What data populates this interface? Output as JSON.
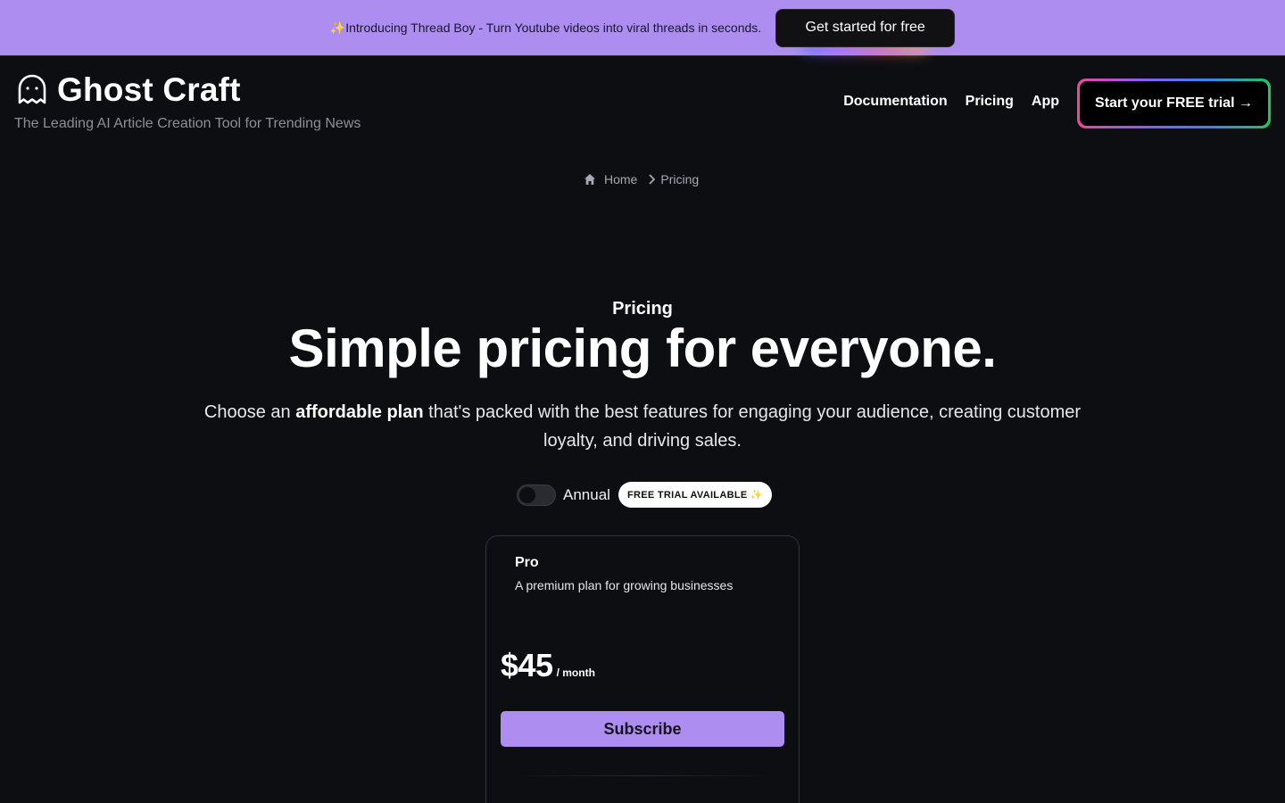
{
  "banner": {
    "text": "✨Introducing Thread Boy - Turn Youtube videos into viral threads in seconds.",
    "cta_label": "Get started for free"
  },
  "brand": {
    "name": "Ghost Craft",
    "tagline": "The Leading AI Article Creation Tool for Trending News",
    "icon": "ghost-icon"
  },
  "nav": {
    "items": [
      "Documentation",
      "Pricing",
      "App"
    ],
    "trial_label": "Start your FREE trial →"
  },
  "breadcrumb": {
    "home": "Home",
    "current": "Pricing"
  },
  "hero": {
    "eyebrow": "Pricing",
    "headline": "Simple pricing for everyone.",
    "sub_pre": "Choose an ",
    "sub_bold": "affordable plan",
    "sub_post": " that's packed with the best features for engaging your audience, creating customer loyalty, and driving sales."
  },
  "billing": {
    "toggle_label": "Annual",
    "annual_enabled": false,
    "badge": "FREE TRIAL AVAILABLE ✨"
  },
  "plan": {
    "name": "Pro",
    "description": "A premium plan for growing businesses",
    "price": "$45",
    "period": "/ month",
    "cta": "Subscribe"
  },
  "colors": {
    "accent": "#ad8ef0",
    "background": "#0d0e12"
  }
}
